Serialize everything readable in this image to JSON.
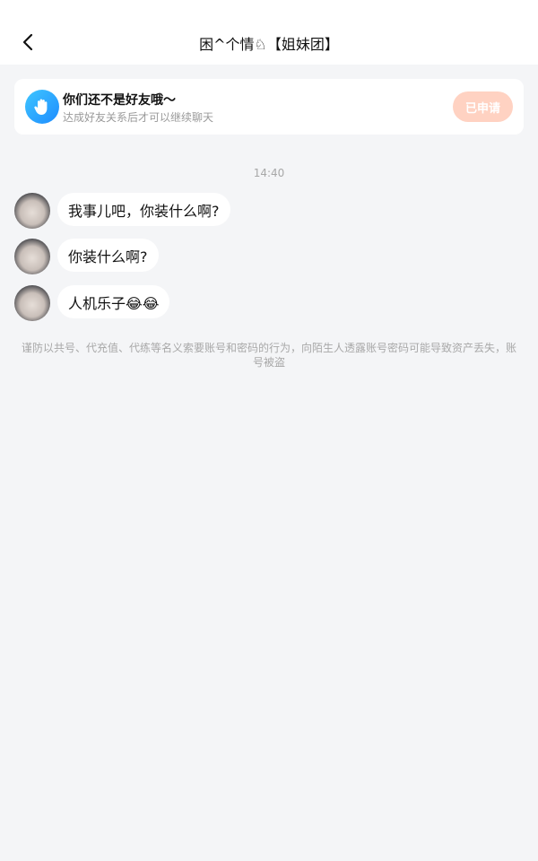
{
  "header": {
    "back_icon": "chevron-left-icon",
    "title": "困^个情♘【姐妹团】"
  },
  "friend_card": {
    "icon": "hand-wave-icon",
    "title": "你们还不是好友哦～",
    "subtitle": "达成好友关系后才可以继续聊天",
    "apply_label": "已申请",
    "apply_color": "#ffd2c2"
  },
  "chat": {
    "timestamp": "14:40",
    "messages": [
      {
        "text": "我事儿吧，你装什么啊?"
      },
      {
        "text": "你装什么啊?"
      },
      {
        "text": "人机乐子😂😂"
      }
    ]
  },
  "notice": "谨防以共号、代充值、代练等名义索要账号和密码的行为，向陌生人透露账号密码可能导致资产丢失，账号被盗",
  "colors": {
    "background": "#f4f5f7",
    "card": "#ffffff",
    "accent_blue": "#1e8cff",
    "muted_text": "#a8a8a8"
  }
}
